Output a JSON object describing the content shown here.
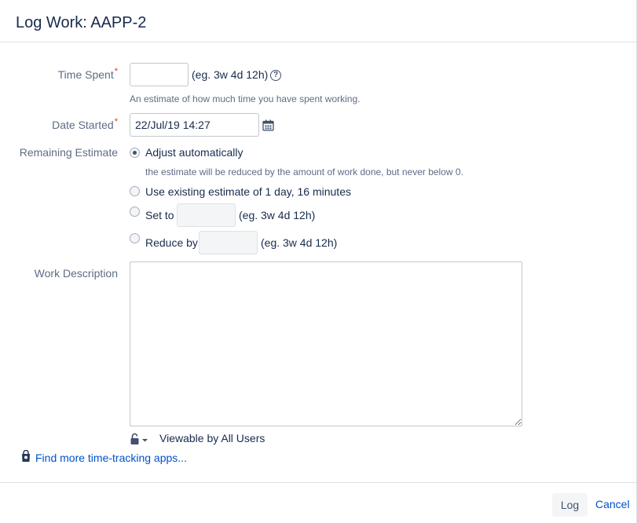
{
  "dialog": {
    "title": "Log Work: AAPP-2"
  },
  "time_spent": {
    "label": "Time Spent",
    "required_mark": "*",
    "value": "",
    "hint": "(eg. 3w 4d 12h)",
    "description": "An estimate of how much time you have spent working."
  },
  "date_started": {
    "label": "Date Started",
    "required_mark": "*",
    "value": "22/Jul/19 14:27"
  },
  "remaining_estimate": {
    "label": "Remaining Estimate",
    "options": [
      {
        "label": "Adjust automatically",
        "checked": true,
        "description": "the estimate will be reduced by the amount of work done, but never below 0."
      },
      {
        "label": "Use existing estimate of 1 day, 16 minutes",
        "checked": false
      },
      {
        "label": "Set to",
        "checked": false,
        "hint": "(eg. 3w 4d 12h)",
        "value": ""
      },
      {
        "label": "Reduce by",
        "checked": false,
        "hint": "(eg. 3w 4d 12h)",
        "value": ""
      }
    ]
  },
  "work_description": {
    "label": "Work Description",
    "value": ""
  },
  "visibility": {
    "label": "Viewable by All Users"
  },
  "find_apps": {
    "label": "Find more time-tracking apps..."
  },
  "footer": {
    "log_label": "Log",
    "cancel_label": "Cancel"
  },
  "colors": {
    "link": "#0052cc",
    "required": "#de350b",
    "label": "#5e6c84"
  }
}
